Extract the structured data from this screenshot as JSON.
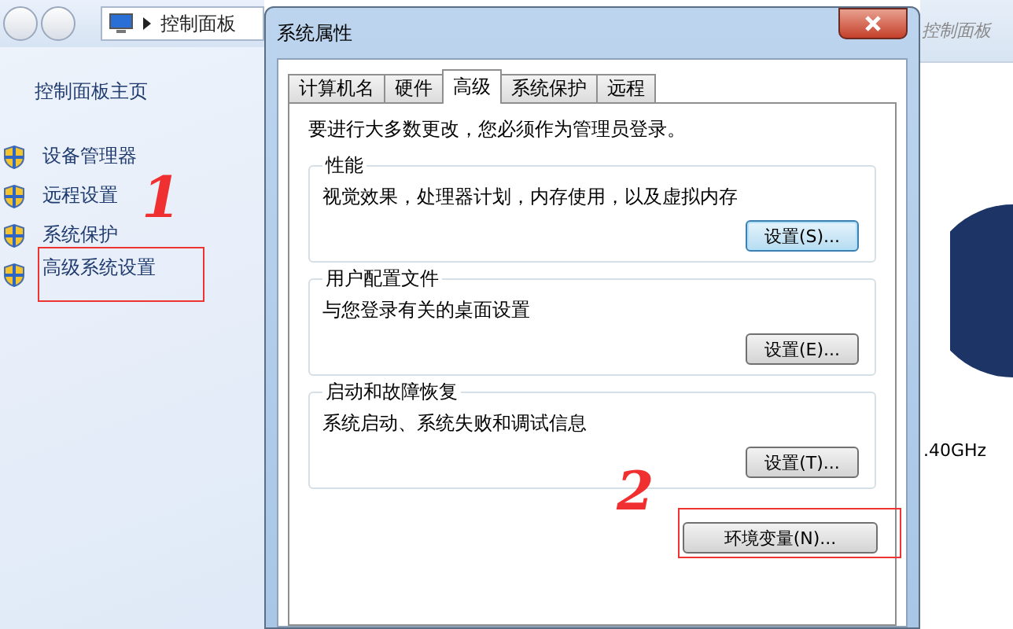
{
  "explorer": {
    "breadcrumb": [
      "控制面板"
    ],
    "sidebar_home": "控制面板主页",
    "sidebar_items": [
      {
        "label": "设备管理器",
        "selected": false
      },
      {
        "label": "远程设置",
        "selected": false
      },
      {
        "label": "系统保护",
        "selected": false
      },
      {
        "label": "高级系统设置",
        "selected": true
      }
    ],
    "right_title": "控制面板",
    "cpu_fragment": ".40GHz"
  },
  "dialog": {
    "title": "系统属性",
    "tabs": [
      {
        "label": "计算机名",
        "selected": false
      },
      {
        "label": "硬件",
        "selected": false
      },
      {
        "label": "高级",
        "selected": true
      },
      {
        "label": "系统保护",
        "selected": false
      },
      {
        "label": "远程",
        "selected": false
      }
    ],
    "notice": "要进行大多数更改，您必须作为管理员登录。",
    "groups": [
      {
        "title": "性能",
        "description": "视觉效果，处理器计划，内存使用，以及虚拟内存",
        "button": "设置(S)...",
        "focused": true
      },
      {
        "title": "用户配置文件",
        "description": "与您登录有关的桌面设置",
        "button": "设置(E)...",
        "focused": false
      },
      {
        "title": "启动和故障恢复",
        "description": "系统启动、系统失败和调试信息",
        "button": "设置(T)...",
        "focused": false
      }
    ],
    "env_button": {
      "label": "环境变量(N)...",
      "highlighted": true
    }
  },
  "annotations": [
    {
      "text": "1"
    },
    {
      "text": "2"
    }
  ]
}
